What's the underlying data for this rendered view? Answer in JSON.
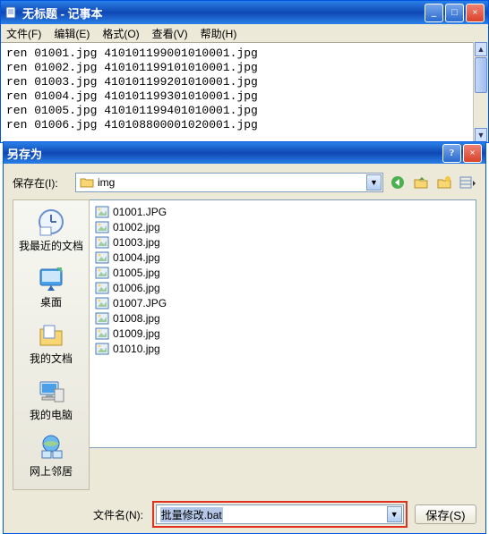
{
  "notepad": {
    "title": "无标题 - 记事本",
    "menu": {
      "file": "文件(F)",
      "edit": "编辑(E)",
      "format": "格式(O)",
      "view": "查看(V)",
      "help": "帮助(H)"
    },
    "lines": [
      "ren 01001.jpg 410101199001010001.jpg",
      "ren 01002.jpg 410101199101010001.jpg",
      "ren 01003.jpg 410101199201010001.jpg",
      "ren 01004.jpg 410101199301010001.jpg",
      "ren 01005.jpg 410101199401010001.jpg",
      "ren 01006.jpg 410108800001020001.jpg"
    ]
  },
  "saveas": {
    "title": "另存为",
    "lookin_label": "保存在(I):",
    "lookin_value": "img",
    "places": [
      {
        "id": "recent",
        "label": "我最近的文档"
      },
      {
        "id": "desktop",
        "label": "桌面"
      },
      {
        "id": "mydocs",
        "label": "我的文档"
      },
      {
        "id": "mycomp",
        "label": "我的电脑"
      },
      {
        "id": "network",
        "label": "网上邻居"
      }
    ],
    "files": [
      "01001.JPG",
      "01002.jpg",
      "01003.jpg",
      "01004.jpg",
      "01005.jpg",
      "01006.jpg",
      "01007.JPG",
      "01008.jpg",
      "01009.jpg",
      "01010.jpg"
    ],
    "filename_label": "文件名(N):",
    "filename_value": "批量修改.bat",
    "save_btn": "保存(S)"
  }
}
